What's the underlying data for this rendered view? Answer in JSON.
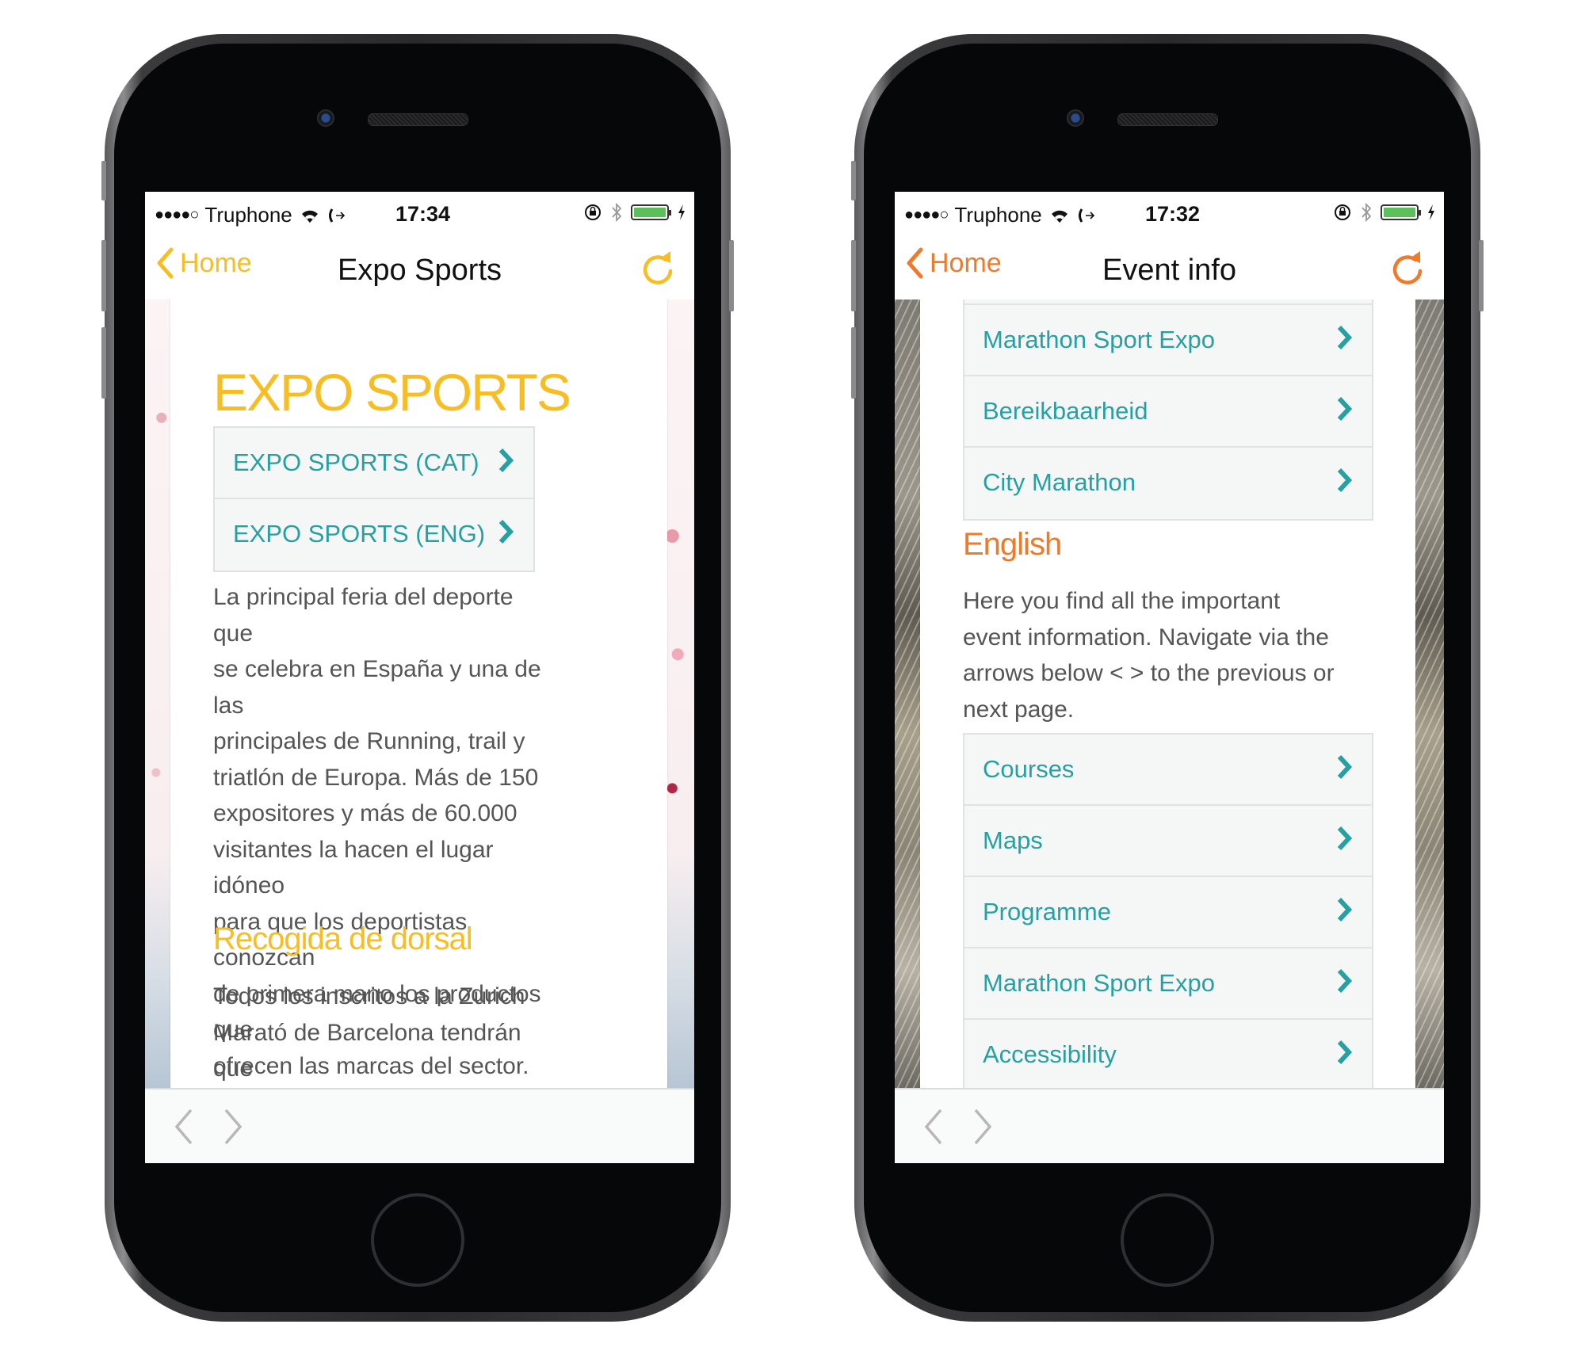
{
  "phones": [
    {
      "status": {
        "signal": "●●●●○",
        "carrier": "Truphone",
        "time": "17:34",
        "wifi_icon": "wifi-icon",
        "call_forward_icon": "call-forward-icon",
        "rotation_lock_icon": "rotation-lock-icon",
        "bluetooth_icon": "bluetooth-icon",
        "battery_icon": "battery-icon",
        "charging_icon": "charging-icon"
      },
      "nav": {
        "back_label": "Home",
        "title": "Expo Sports",
        "refresh_icon": "refresh-icon",
        "accent": "#f7bd22"
      },
      "content": {
        "heading": "EXPO SPORTS",
        "links": [
          {
            "label": "EXPO SPORTS (CAT)"
          },
          {
            "label": "EXPO SPORTS (ENG)"
          }
        ],
        "paragraph_lines": [
          "La principal feria del deporte que",
          "se celebra en España y una de las",
          "principales de Running, trail y",
          "triatlón de Europa. Más de 150",
          "expositores y más de 60.000",
          "visitantes la hacen el lugar idóneo",
          "para que los deportistas conozcan",
          "de primera mano los productos que",
          "ofrecen las marcas del sector."
        ],
        "subheading": "Recogida de dorsal",
        "paragraph2_lines": [
          "Todos los inscritos a la Zurich",
          "Marató de Barcelona tendrán que"
        ]
      },
      "bottom": {
        "prev_icon": "chevron-left-icon",
        "next_icon": "chevron-right-icon"
      }
    },
    {
      "status": {
        "signal": "●●●●○",
        "carrier": "Truphone",
        "time": "17:32",
        "wifi_icon": "wifi-icon",
        "call_forward_icon": "call-forward-icon",
        "rotation_lock_icon": "rotation-lock-icon",
        "bluetooth_icon": "bluetooth-icon",
        "battery_icon": "battery-icon",
        "charging_icon": "charging-icon"
      },
      "nav": {
        "back_label": "Home",
        "title": "Event info",
        "refresh_icon": "refresh-icon",
        "accent": "#ee7a2a"
      },
      "content": {
        "links_top": [
          {
            "label": "Marathon Sport Expo"
          },
          {
            "label": "Bereikbaarheid"
          },
          {
            "label": "City Marathon"
          }
        ],
        "section_heading": "English",
        "paragraph_lines": [
          "Here you find all the important",
          "event information. Navigate via the",
          "arrows below < > to the previous or",
          "next page."
        ],
        "links_bottom": [
          {
            "label": "Courses"
          },
          {
            "label": "Maps"
          },
          {
            "label": "Programme"
          },
          {
            "label": "Marathon Sport Expo"
          },
          {
            "label": "Accessibility"
          }
        ]
      },
      "bottom": {
        "prev_icon": "chevron-left-icon",
        "next_icon": "chevron-right-icon"
      }
    }
  ],
  "colors": {
    "link_teal": "#26a0a3",
    "left_accent": "#f7bd22",
    "right_accent": "#ee7a2a",
    "body_text": "#555555",
    "battery_green": "#5cbf5c"
  }
}
